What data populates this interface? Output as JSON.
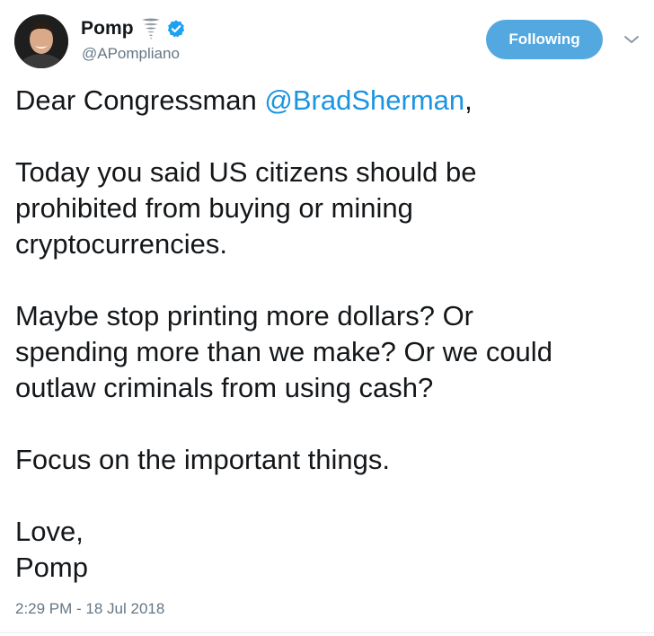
{
  "author": {
    "display_name": "Pomp",
    "emoji": "tornado",
    "verified": true,
    "handle": "@APompliano",
    "avatar": "profile-photo"
  },
  "follow_button": {
    "label": "Following"
  },
  "menu": {
    "icon": "chevron-down-icon"
  },
  "tweet": {
    "line1_prefix": "Dear Congressman ",
    "mention": "@BradSherman",
    "line1_suffix": ",",
    "para2_line1": "Today you said US citizens should be",
    "para2_line2": "prohibited from buying or mining",
    "para2_line3": "cryptocurrencies.",
    "para3_line1": "Maybe stop printing more dollars? Or",
    "para3_line2": "spending more than we make? Or we could",
    "para3_line3": "outlaw criminals from using cash?",
    "para4": "Focus on the important things.",
    "sign_line1": "Love,",
    "sign_line2": "Pomp"
  },
  "timestamp": "2:29 PM - 18 Jul 2018",
  "colors": {
    "link": "#1b95e0",
    "button": "#54a8e0",
    "secondary_text": "#657786",
    "verified": "#1da1f2"
  }
}
